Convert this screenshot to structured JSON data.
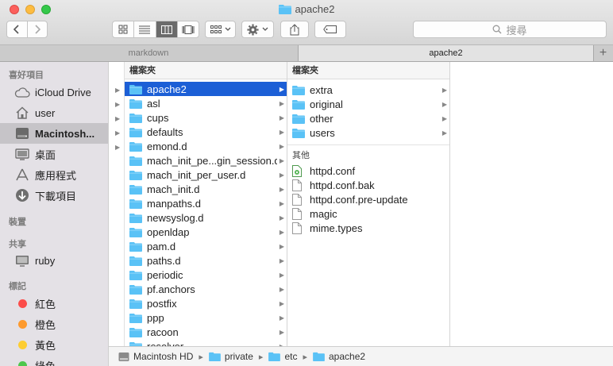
{
  "window": {
    "title": "apache2"
  },
  "toolbar": {
    "search_placeholder": "搜尋",
    "search_icon": "magnifier-icon",
    "action_icon": "gear-icon",
    "share_icon": "share-icon",
    "tag_icon": "tag-icon"
  },
  "tabs": [
    {
      "label": "markdown",
      "active": false
    },
    {
      "label": "apache2",
      "active": true
    }
  ],
  "sidebar": {
    "favorites_heading": "喜好項目",
    "favorites": [
      {
        "label": "iCloud Drive",
        "icon": "cloud-icon"
      },
      {
        "label": "user",
        "icon": "home-icon"
      },
      {
        "label": "Macintosh...",
        "icon": "hard-drive-icon",
        "selected": true
      },
      {
        "label": "桌面",
        "icon": "desktop-icon"
      },
      {
        "label": "應用程式",
        "icon": "applications-icon"
      },
      {
        "label": "下載項目",
        "icon": "downloads-icon"
      }
    ],
    "devices_heading": "裝置",
    "shared_heading": "共享",
    "shared": [
      {
        "label": "ruby",
        "icon": "monitor-icon"
      }
    ],
    "tags_heading": "標記",
    "tags": [
      {
        "label": "紅色",
        "color": "#fc4d4a"
      },
      {
        "label": "橙色",
        "color": "#fd9a2e"
      },
      {
        "label": "黃色",
        "color": "#fdcd31"
      },
      {
        "label": "綠色",
        "color": "#4ec74c"
      }
    ]
  },
  "column2": {
    "header": "檔案夾",
    "items": [
      {
        "name": "apache2",
        "selected": true
      },
      {
        "name": "asl"
      },
      {
        "name": "cups"
      },
      {
        "name": "defaults"
      },
      {
        "name": "emond.d"
      },
      {
        "name": "mach_init_pe...gin_session.d"
      },
      {
        "name": "mach_init_per_user.d"
      },
      {
        "name": "mach_init.d"
      },
      {
        "name": "manpaths.d"
      },
      {
        "name": "newsyslog.d"
      },
      {
        "name": "openldap"
      },
      {
        "name": "pam.d"
      },
      {
        "name": "paths.d"
      },
      {
        "name": "periodic"
      },
      {
        "name": "pf.anchors"
      },
      {
        "name": "postfix"
      },
      {
        "name": "ppp"
      },
      {
        "name": "racoon"
      },
      {
        "name": "resolver"
      }
    ]
  },
  "column3": {
    "header": "檔案夾",
    "folders": [
      {
        "name": "extra"
      },
      {
        "name": "original"
      },
      {
        "name": "other"
      },
      {
        "name": "users"
      }
    ],
    "other_heading": "其他",
    "files": [
      {
        "name": "httpd.conf",
        "icon": "config-file-icon"
      },
      {
        "name": "httpd.conf.bak",
        "icon": "document-icon"
      },
      {
        "name": "httpd.conf.pre-update",
        "icon": "document-icon"
      },
      {
        "name": "magic",
        "icon": "document-icon"
      },
      {
        "name": "mime.types",
        "icon": "document-icon"
      }
    ]
  },
  "pathbar": [
    {
      "label": "Macintosh HD",
      "icon": "hard-drive-icon"
    },
    {
      "label": "private",
      "icon": "folder-icon"
    },
    {
      "label": "etc",
      "icon": "folder-icon"
    },
    {
      "label": "apache2",
      "icon": "folder-icon"
    }
  ]
}
